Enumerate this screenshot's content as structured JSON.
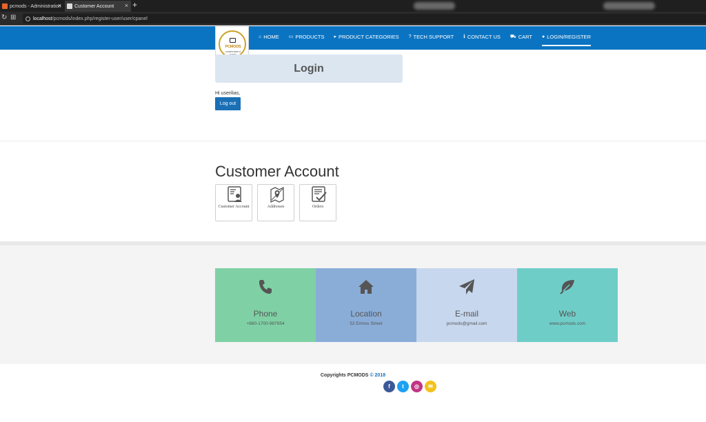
{
  "browser": {
    "tabs": [
      {
        "title": "pcmods - Administration",
        "favicon_color": "#e8632c"
      },
      {
        "title": "Customer Account",
        "favicon_color": "#dddddd"
      }
    ],
    "url_host": "localhost",
    "url_path": "/pcmods/index.php/register-user/user/cpanel"
  },
  "logo": {
    "text": "PCMODS",
    "subtext": "COMPUTERS & PARTS"
  },
  "menu": [
    {
      "icon": "home-icon",
      "glyph": "⌂",
      "label": "HOME"
    },
    {
      "icon": "monitor-icon",
      "glyph": "▭",
      "label": "PRODUCTS"
    },
    {
      "icon": "pointer-icon",
      "glyph": "▸",
      "label": "PRODUCT CATEGORIES"
    },
    {
      "icon": "question-icon",
      "glyph": "?",
      "label": "TECH SUPPORT"
    },
    {
      "icon": "info-icon",
      "glyph": "ℹ",
      "label": "CONTACT US"
    },
    {
      "icon": "cart-icon",
      "glyph": "⛟",
      "label": "CART"
    },
    {
      "icon": "user-icon",
      "glyph": "●",
      "label": "LOGIN/REGISTER"
    }
  ],
  "login": {
    "title": "Login",
    "greeting": "Hi userilias,",
    "logout_label": "Log out"
  },
  "account": {
    "title": "Customer Account",
    "cards": [
      {
        "label": "Customer Account",
        "icon": "customer-account-icon"
      },
      {
        "label": "Addresses",
        "icon": "map-pin-icon"
      },
      {
        "label": "Orders",
        "icon": "checklist-icon"
      }
    ]
  },
  "contacts": [
    {
      "title": "Phone",
      "value": "+880-1700-987654",
      "icon": "phone-icon",
      "color": "#7fd1a5"
    },
    {
      "title": "Location",
      "value": "52 Ermou Street",
      "icon": "home-icon",
      "color": "#8aadd8"
    },
    {
      "title": "E-mail",
      "value": "pcmods@gmail.com",
      "icon": "paper-plane-icon",
      "color": "#c6d7ee"
    },
    {
      "title": "Web",
      "value": "www.pcmods.com",
      "icon": "leaf-icon",
      "color": "#6fcdc8"
    }
  ],
  "footer": {
    "copyright": "Copyrights PCMODS",
    "year": "© 2018",
    "social": [
      {
        "name": "facebook-icon",
        "glyph": "f",
        "color": "#3b5998"
      },
      {
        "name": "twitter-icon",
        "glyph": "t",
        "color": "#1da1f2"
      },
      {
        "name": "instagram-icon",
        "glyph": "◎",
        "color": "#c13584"
      },
      {
        "name": "email-icon",
        "glyph": "✉",
        "color": "#f2c11b"
      }
    ]
  }
}
